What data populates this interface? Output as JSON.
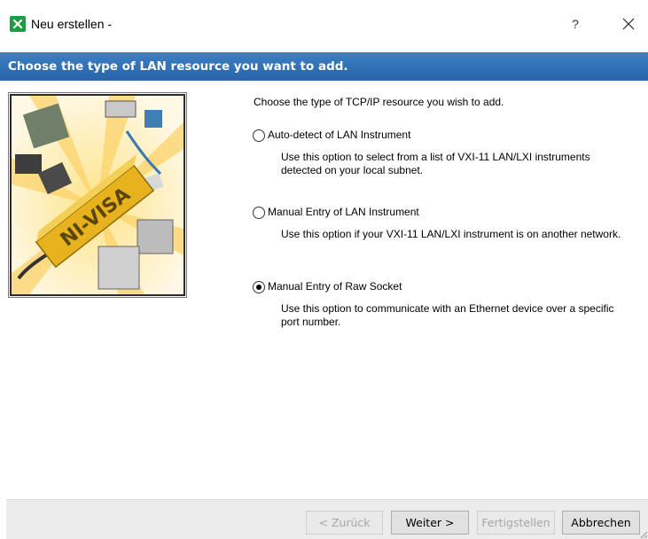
{
  "window": {
    "title": "Neu erstellen -",
    "help_label": "?",
    "app_icon": "ni-max-icon",
    "close_icon": "close-icon"
  },
  "banner": {
    "text": "Choose the type of LAN resource you want to add.",
    "color": "#2f6eb5"
  },
  "image": {
    "label": "NI-VISA"
  },
  "main": {
    "intro": "Choose the type of TCP/IP resource you wish to add.",
    "options": [
      {
        "label": "Auto-detect of LAN Instrument",
        "description": "Use this option to select from a list of VXI-11 LAN/LXI instruments detected on your local subnet.",
        "selected": false
      },
      {
        "label": "Manual Entry of LAN Instrument",
        "description": "Use this option if your VXI-11 LAN/LXI instrument is on another network.",
        "selected": false
      },
      {
        "label": "Manual Entry of Raw Socket",
        "description": "Use this option to communicate with an Ethernet device over a specific port number.",
        "selected": true
      }
    ]
  },
  "footer": {
    "back_label": "< Zurück",
    "next_label": "Weiter >",
    "finish_label": "Fertigstellen",
    "cancel_label": "Abbrechen"
  }
}
